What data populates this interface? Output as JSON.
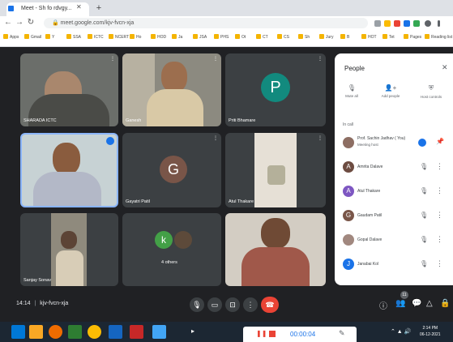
{
  "browser": {
    "tab_title": "Meet - Sh fo rdvgy...",
    "url": "meet.google.com/kjv-fvcn-xja",
    "bookmarks": [
      "Gmail",
      "Y",
      "SSA",
      "ICTC",
      "NCERT",
      "Ho",
      "HOD",
      "Ja",
      "JSA",
      "PHS",
      "Ot",
      "CT",
      "CS",
      "Sh",
      "Jury",
      "B",
      "HOT",
      "Tet",
      "Pages",
      "Reading list"
    ]
  },
  "tiles": [
    {
      "name": "SHARADA ICTC"
    },
    {
      "name": "Ganesh"
    },
    {
      "name": "Priti Bhamare",
      "initial": "P"
    },
    {
      "name": ""
    },
    {
      "name": "Gayatri Patil",
      "initial": "G"
    },
    {
      "name": "Atul Thakare"
    },
    {
      "name": "Sanjay Sonav"
    },
    {
      "name": "4 others",
      "initial": "k"
    },
    {
      "name": ""
    }
  ],
  "people": {
    "title": "People",
    "actions": [
      {
        "label": "Mute all",
        "icon": "mic-off-icon"
      },
      {
        "label": "Add people",
        "icon": "add-person-icon"
      },
      {
        "label": "Host controls",
        "icon": "host-controls-icon"
      }
    ],
    "section": "In call",
    "participants": [
      {
        "name": "Prof. Sachin Jadhav ( You)",
        "sub": "Meeting host",
        "initial": "",
        "color": "#8d6e63"
      },
      {
        "name": "Amrita Dalave",
        "initial": "A",
        "color": "#6d4c41"
      },
      {
        "name": "Atul Thakare",
        "initial": "A",
        "color": "#7e57c2"
      },
      {
        "name": "Gaudam Patil",
        "initial": "G",
        "color": "#795548"
      },
      {
        "name": "Gopal Dalave",
        "initial": "",
        "color": "#a1887f"
      },
      {
        "name": "Janabai Kol",
        "initial": "J",
        "color": "#1a73e8"
      }
    ]
  },
  "meeting": {
    "time": "14:14",
    "code": "kjv-fvcn-xja",
    "people_count": "11"
  },
  "recorder": {
    "time": "00:00:04"
  },
  "tray": {
    "time": "2:14 PM",
    "date": "06-12-2021"
  }
}
